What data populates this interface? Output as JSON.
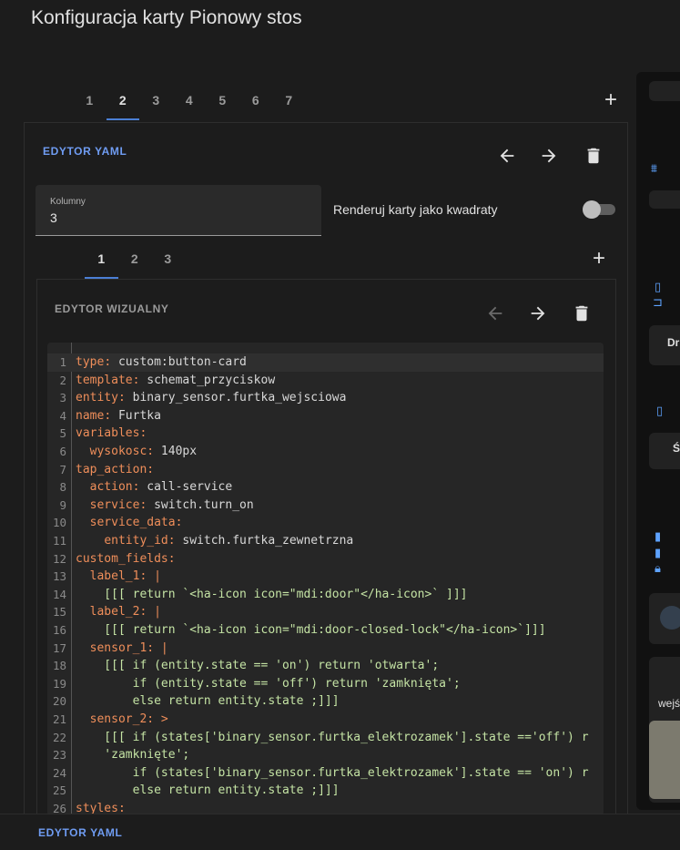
{
  "dialog": {
    "title": "Konfiguracja karty Pionowy stos",
    "outer_tabs": [
      "1",
      "2",
      "3",
      "4",
      "5",
      "6",
      "7"
    ],
    "outer_active": "2",
    "yaml_editor_label": "EDYTOR YAML",
    "footer_link": "EDYTOR YAML"
  },
  "grid_config": {
    "columns_label": "Kolumny",
    "columns_value": "3",
    "square_label": "Renderuj karty jako kwadraty",
    "square_enabled": false
  },
  "inner": {
    "tabs": [
      "1",
      "2",
      "3"
    ],
    "active": "1",
    "visual_editor_label": "EDYTOR WIZUALNY"
  },
  "code": {
    "lines": [
      {
        "n": "1",
        "key": "type",
        "rest": " custom:button-card"
      },
      {
        "n": "2",
        "key": "template",
        "rest": " schemat_przyciskow"
      },
      {
        "n": "3",
        "key": "entity",
        "rest": " binary_sensor.furtka_wejsciowa"
      },
      {
        "n": "4",
        "key": "name",
        "rest": " Furtka"
      },
      {
        "n": "5",
        "key": "variables",
        "rest": ""
      },
      {
        "n": "6",
        "indent": "  ",
        "key": "wysokosc",
        "rest": " 140px"
      },
      {
        "n": "7",
        "key": "tap_action",
        "rest": ""
      },
      {
        "n": "8",
        "indent": "  ",
        "key": "action",
        "rest": " call-service"
      },
      {
        "n": "9",
        "indent": "  ",
        "key": "service",
        "rest": " switch.turn_on"
      },
      {
        "n": "10",
        "indent": "  ",
        "key": "service_data",
        "rest": ""
      },
      {
        "n": "11",
        "indent": "    ",
        "key": "entity_id",
        "rest": " switch.furtka_zewnetrzna"
      },
      {
        "n": "12",
        "key": "custom_fields",
        "rest": ""
      },
      {
        "n": "13",
        "indent": "  ",
        "key": "label_1",
        "rest": " |"
      },
      {
        "n": "14",
        "text": "    [[[ return `<ha-icon icon=\"mdi:door\"</ha-icon>` ]]]"
      },
      {
        "n": "15",
        "indent": "  ",
        "key": "label_2",
        "rest": " |"
      },
      {
        "n": "16",
        "text": "    [[[ return `<ha-icon icon=\"mdi:door-closed-lock\"</ha-icon>`]]]"
      },
      {
        "n": "17",
        "indent": "  ",
        "key": "sensor_1",
        "rest": " |"
      },
      {
        "n": "18",
        "text": "    [[[ if (entity.state == 'on') return 'otwarta';"
      },
      {
        "n": "19",
        "text": "        if (entity.state == 'off') return 'zamknięta';"
      },
      {
        "n": "20",
        "text": "        else return entity.state ;]]]"
      },
      {
        "n": "21",
        "indent": "  ",
        "key": "sensor_2",
        "rest": " >"
      },
      {
        "n": "22",
        "text": "    [[[ if (states['binary_sensor.furtka_elektrozamek'].state =='off') r"
      },
      {
        "n": "23",
        "text": "    'zamknięte';"
      },
      {
        "n": "24",
        "text": "        if (states['binary_sensor.furtka_elektrozamek'].state == 'on') r"
      },
      {
        "n": "25",
        "text": "        else return entity.state ;]]]"
      },
      {
        "n": "26",
        "key": "styles",
        "rest": ""
      }
    ]
  },
  "preview": {
    "snippets": [
      "Dr",
      "Ś",
      "wejś"
    ]
  },
  "colors": {
    "accent": "#4b7fd4",
    "link": "#6f9cf2",
    "yaml_key": "#ef8e5a",
    "yaml_value": "#c4e3a4"
  }
}
